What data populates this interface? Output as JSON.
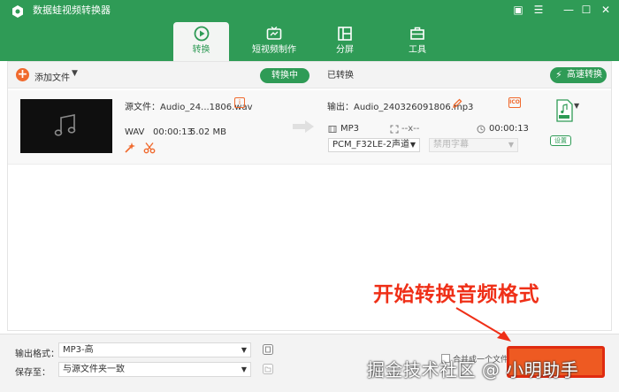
{
  "app": {
    "title": "数据蛙视频转换器"
  },
  "tabs": [
    {
      "label": "转换",
      "icon": "convert-icon"
    },
    {
      "label": "短视频制作",
      "icon": "tv-icon"
    },
    {
      "label": "分屏",
      "icon": "split-screen-icon"
    },
    {
      "label": "工具",
      "icon": "toolbox-icon"
    }
  ],
  "toolbar": {
    "add_label": "添加文件",
    "converting_label": "转换中",
    "converted_label": "已转换",
    "highspeed_label": "高速转换"
  },
  "file": {
    "source_label": "源文件：Audio_24...1806.wav",
    "format": "WAV",
    "duration": "00:00:13",
    "size": "5.02 MB",
    "output_label": "输出：Audio_240326091806.mp3",
    "out_format": "MP3",
    "out_resolution": "--x--",
    "out_duration": "00:00:13",
    "audio_track": "PCM_F32LE-2声道",
    "subtitle": "禁用字幕",
    "settings_label": "设置",
    "format_badge": "ICO"
  },
  "bottom": {
    "output_format_label": "输出格式：",
    "output_format_value": "MP3-高",
    "save_label": "保存至：",
    "save_value": "与源文件夹一致",
    "merge_label": "合并成一个文件"
  },
  "annotation": {
    "text": "开始转换音频格式"
  },
  "watermark": "掘金技术社区 @ 小明助手",
  "colors": {
    "brand": "#2f9b56",
    "accent": "#f06a2e",
    "highlight": "#ef2f17"
  }
}
